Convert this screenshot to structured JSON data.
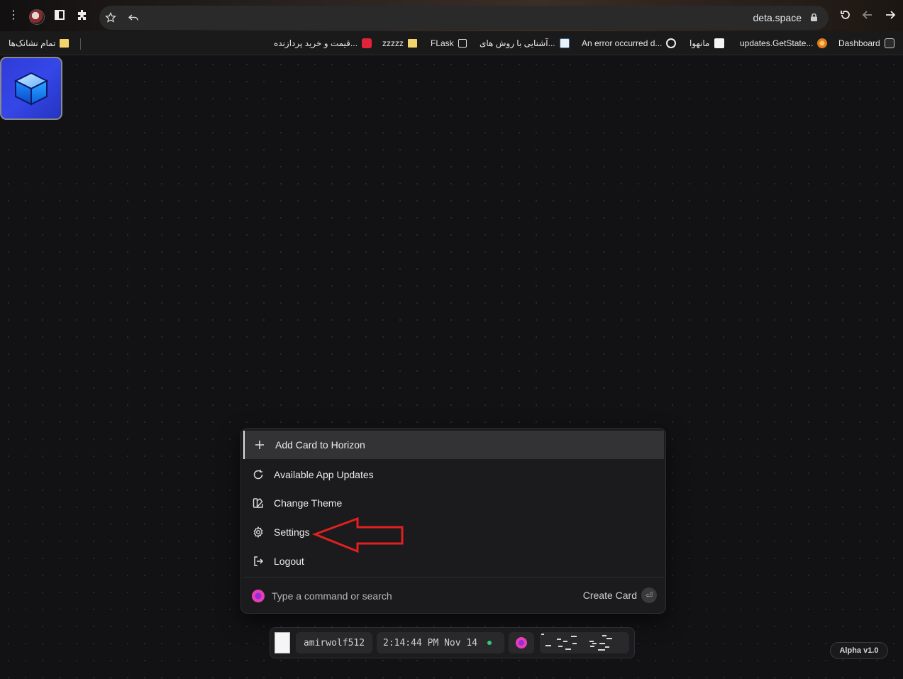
{
  "browser": {
    "url": "deta.space",
    "bookmarks": {
      "all_bookmarks": "تمام نشانک‌ها",
      "items": [
        {
          "label": "قیمت و خرید پردازنده..."
        },
        {
          "label": "zzzzz"
        },
        {
          "label": "FLask"
        },
        {
          "label": "آشنایی با روش های..."
        },
        {
          "label": "An error occurred d..."
        },
        {
          "label": "مانهوا"
        },
        {
          "label": "updates.GetState..."
        },
        {
          "label": "Dashboard"
        }
      ]
    }
  },
  "palette": {
    "items": [
      {
        "label": "Add Card to Horizon",
        "icon": "plus-icon"
      },
      {
        "label": "Available App Updates",
        "icon": "refresh-icon"
      },
      {
        "label": "Change Theme",
        "icon": "theme-icon"
      },
      {
        "label": "Settings",
        "icon": "gear-icon"
      },
      {
        "label": "Logout",
        "icon": "logout-icon"
      }
    ],
    "search_placeholder": "Type a command or search",
    "create_card": "Create Card",
    "enter_symbol": "⏎"
  },
  "dock": {
    "username": "amirwolf512",
    "datetime": "2:14:44 PM Nov 14"
  },
  "version": "Alpha v1.0",
  "colors": {
    "accent_pink": "#e83fb4",
    "status_green": "#2ecc71",
    "annotation_red": "#e02020"
  }
}
